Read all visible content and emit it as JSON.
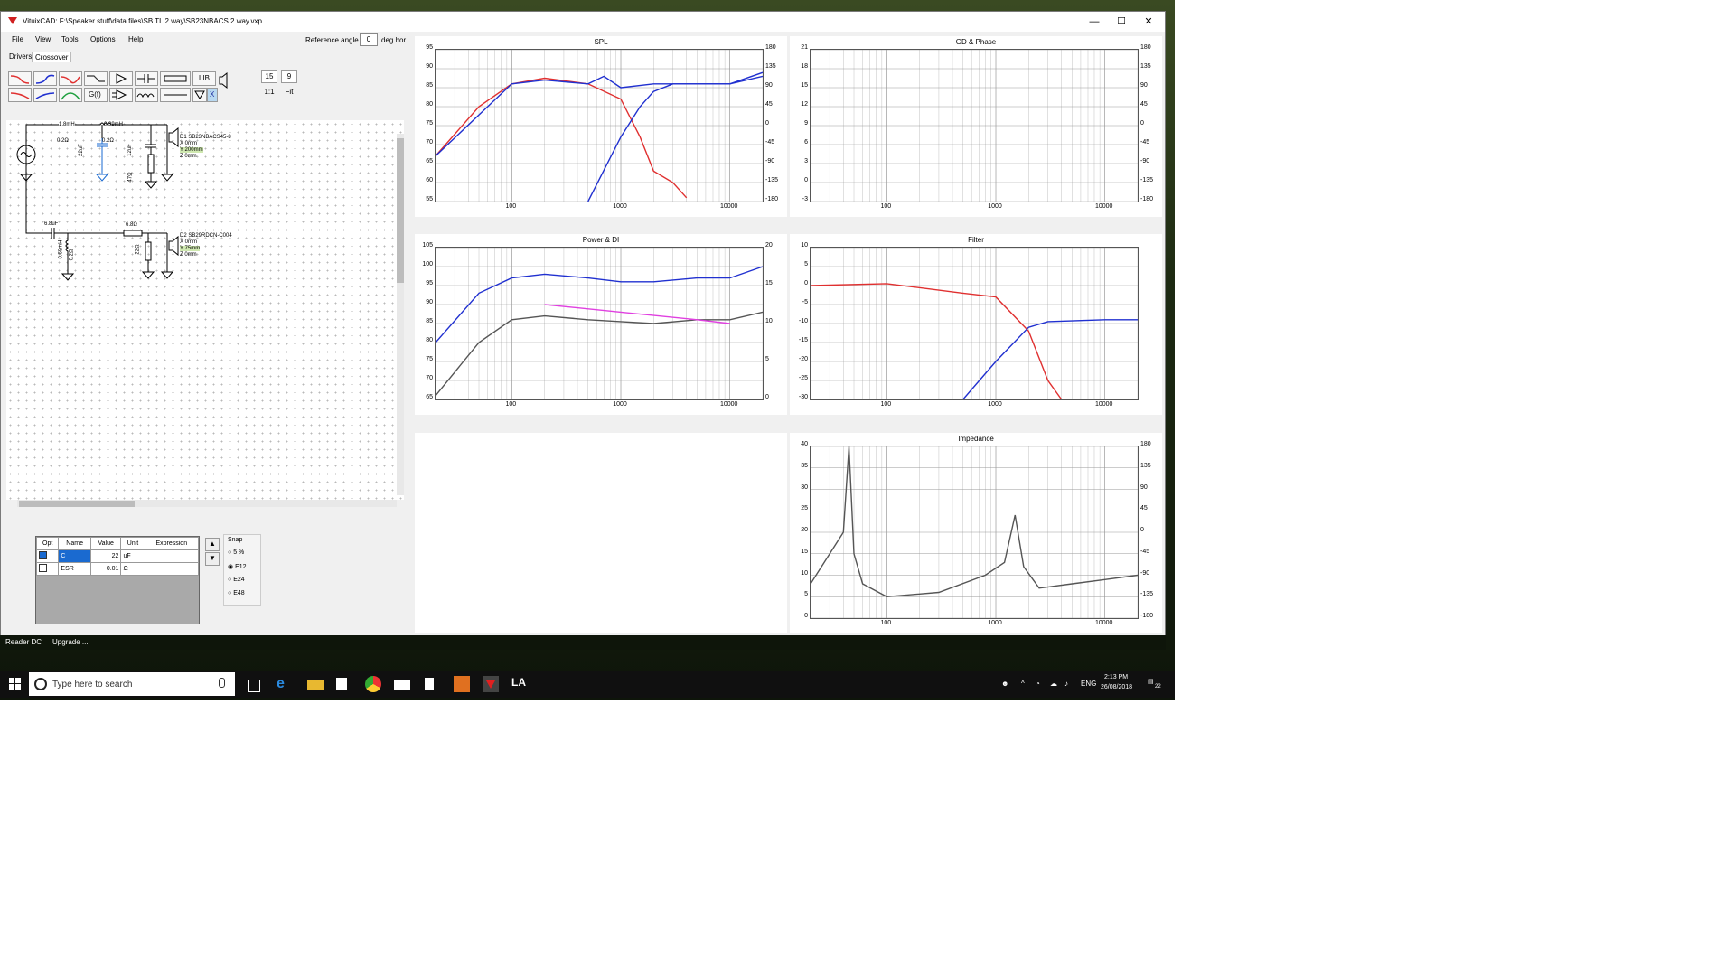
{
  "window": {
    "title": "VituixCAD: F:\\Speaker stuff\\data files\\SB TL 2 way\\SB23NBACS 2 way.vxp",
    "minimize": "—",
    "maximize": "☐",
    "close": "✕"
  },
  "menu": [
    "File",
    "View",
    "Tools",
    "Options",
    "Help"
  ],
  "reference_angle": {
    "label": "Reference angle",
    "value": "0",
    "unit": "deg hor"
  },
  "tabs": [
    "Drivers",
    "Crossover"
  ],
  "toolbar": {
    "lib_label": "LIB",
    "gf_label": "G(f)",
    "x_label": "X",
    "num1": "15",
    "num2": "9",
    "ratio": "1:1",
    "fit": "Fit"
  },
  "schematic": {
    "l1": "1.8mH",
    "r1": "0.2Ω",
    "c1": "22uF",
    "l2": "0.39mH",
    "r2": "0.2Ω",
    "c2": "12uF",
    "r3": "47Ω",
    "d1_name": "D1 SB23NBACS45-8",
    "d1_x": "X 0mm",
    "d1_y": "Y 200mm",
    "d1_z": "Z 0mm",
    "c3": "6.8uF",
    "l3": "0.68mH",
    "r4": "0.2Ω",
    "r5": "6.8Ω",
    "r6": "22Ω",
    "d2_name": "D2 SB29RDCN-C004",
    "d2_x": "X 0mm",
    "d2_y": "Y 75mm",
    "d2_z": "Z 0mm"
  },
  "params": {
    "headers": [
      "Opt",
      "Name",
      "Value",
      "Unit",
      "Expression"
    ],
    "rows": [
      {
        "name": "C",
        "value": "22",
        "unit": "uF"
      },
      {
        "name": "ESR",
        "value": "0.01",
        "unit": "Ω"
      }
    ]
  },
  "snap": {
    "title": "Snap",
    "options": [
      "5 %",
      "E12",
      "E24",
      "E48"
    ],
    "selected": "E12"
  },
  "status": {
    "left1": "Reader DC",
    "left2": "Upgrade ..."
  },
  "taskbar": {
    "search_placeholder": "Type here to search",
    "clock_time": "2:13 PM",
    "clock_date": "26/08/2018",
    "lang": "ENG",
    "notif_count": "22"
  },
  "colors": {
    "red": "#e03030",
    "blue": "#2030d0",
    "gray": "#555555",
    "lightgray": "#aaaaaa",
    "magenta": "#e040e0"
  },
  "chart_data": [
    {
      "type": "line",
      "title": "SPL",
      "x_ticks": [
        "100",
        "1000",
        "10000"
      ],
      "y_left": [
        "95",
        "90",
        "85",
        "80",
        "75",
        "70",
        "65",
        "60",
        "55"
      ],
      "y_right": [
        "180",
        "135",
        "90",
        "45",
        "0",
        "-45",
        "-90",
        "-135",
        "-180"
      ],
      "series": [
        {
          "values": [
            [
              20,
              67
            ],
            [
              50,
              80
            ],
            [
              100,
              86
            ],
            [
              200,
              87.5
            ],
            [
              500,
              86
            ],
            [
              1000,
              82
            ],
            [
              1500,
              72
            ],
            [
              2000,
              63
            ],
            [
              3000,
              60
            ],
            [
              4000,
              56
            ]
          ]
        },
        {
          "values": [
            [
              500,
              55
            ],
            [
              1000,
              72
            ],
            [
              1500,
              80
            ],
            [
              2000,
              84
            ],
            [
              3000,
              86
            ],
            [
              5000,
              86
            ],
            [
              10000,
              86
            ],
            [
              20000,
              88
            ]
          ]
        },
        {
          "values": [
            [
              20,
              67
            ],
            [
              100,
              86
            ],
            [
              200,
              87
            ],
            [
              500,
              86
            ],
            [
              700,
              88
            ],
            [
              1000,
              85
            ],
            [
              2000,
              86
            ],
            [
              5000,
              86
            ],
            [
              10000,
              86
            ],
            [
              20000,
              89
            ]
          ]
        }
      ]
    },
    {
      "type": "line",
      "title": "GD & Phase",
      "x_ticks": [
        "100",
        "1000",
        "10000"
      ],
      "y_left": [
        "21",
        "18",
        "15",
        "12",
        "9",
        "6",
        "3",
        "0",
        "-3"
      ],
      "y_right": [
        "180",
        "135",
        "90",
        "45",
        "0",
        "-45",
        "-90",
        "-135",
        "-180"
      ]
    },
    {
      "type": "line",
      "title": "Power & DI",
      "x_ticks": [
        "100",
        "1000",
        "10000"
      ],
      "y_left": [
        "105",
        "100",
        "95",
        "90",
        "85",
        "80",
        "75",
        "70",
        "65"
      ],
      "y_right": [
        "20",
        "15",
        "10",
        "5",
        "0"
      ],
      "series": [
        {
          "values": [
            [
              20,
              80
            ],
            [
              50,
              93
            ],
            [
              100,
              97
            ],
            [
              200,
              98
            ],
            [
              500,
              97
            ],
            [
              1000,
              96
            ],
            [
              2000,
              96
            ],
            [
              5000,
              97
            ],
            [
              10000,
              97
            ],
            [
              20000,
              100
            ]
          ]
        },
        {
          "values": [
            [
              20,
              66
            ],
            [
              50,
              80
            ],
            [
              100,
              86
            ],
            [
              200,
              87
            ],
            [
              500,
              86
            ],
            [
              1000,
              85.5
            ],
            [
              2000,
              85
            ],
            [
              5000,
              86
            ],
            [
              10000,
              86
            ],
            [
              20000,
              88
            ]
          ]
        },
        {
          "values": [
            [
              200,
              90
            ],
            [
              1000,
              88
            ],
            [
              5000,
              86
            ],
            [
              10000,
              85
            ]
          ]
        }
      ]
    },
    {
      "type": "line",
      "title": "Filter",
      "x_ticks": [
        "100",
        "1000",
        "10000"
      ],
      "y_left": [
        "10",
        "5",
        "0",
        "-5",
        "-10",
        "-15",
        "-20",
        "-25",
        "-30"
      ],
      "series": [
        {
          "values": [
            [
              20,
              0
            ],
            [
              100,
              0.5
            ],
            [
              500,
              -2
            ],
            [
              1000,
              -3
            ],
            [
              2000,
              -12
            ],
            [
              3000,
              -25
            ],
            [
              4000,
              -30
            ]
          ]
        },
        {
          "values": [
            [
              500,
              -30
            ],
            [
              1000,
              -20
            ],
            [
              2000,
              -11
            ],
            [
              3000,
              -9.5
            ],
            [
              10000,
              -9
            ],
            [
              20000,
              -9
            ]
          ]
        }
      ]
    },
    {
      "type": "line",
      "title": "Impedance",
      "x_ticks": [
        "100",
        "1000",
        "10000"
      ],
      "y_left": [
        "40",
        "35",
        "30",
        "25",
        "20",
        "15",
        "10",
        "5",
        "0"
      ],
      "y_right": [
        "180",
        "135",
        "90",
        "45",
        "0",
        "-45",
        "-90",
        "-135",
        "-180"
      ],
      "series": [
        {
          "values": [
            [
              20,
              8
            ],
            [
              40,
              20
            ],
            [
              45,
              40
            ],
            [
              50,
              15
            ],
            [
              60,
              8
            ],
            [
              100,
              5
            ],
            [
              300,
              6
            ],
            [
              800,
              10
            ],
            [
              1200,
              13
            ],
            [
              1500,
              24
            ],
            [
              1800,
              12
            ],
            [
              2500,
              7
            ],
            [
              5000,
              8
            ],
            [
              10000,
              9
            ],
            [
              20000,
              10
            ]
          ]
        }
      ]
    }
  ]
}
